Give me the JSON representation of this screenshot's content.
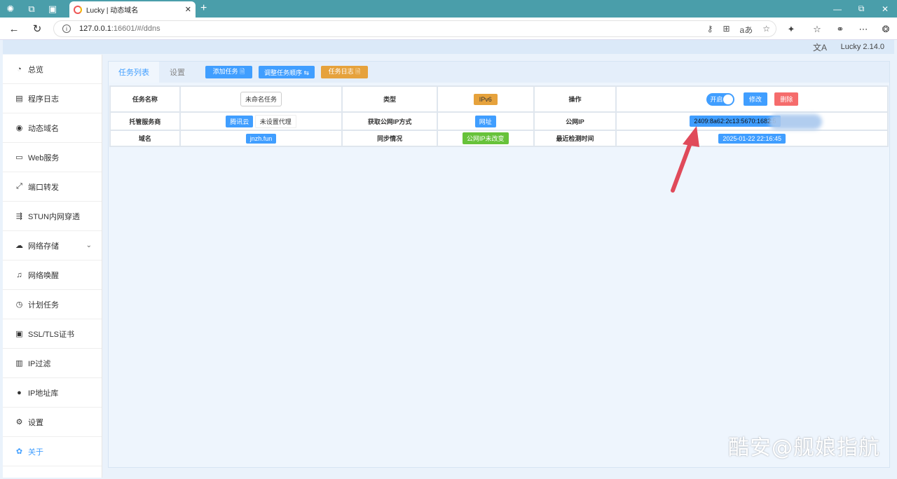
{
  "browser": {
    "tab_title": "Lucky | 动态域名",
    "tab_close": "✕",
    "new_tab": "+",
    "url_host": "127.0.0.1",
    "url_path": ":16601/#/ddns",
    "window_controls": [
      "—",
      "⧉",
      "✕"
    ]
  },
  "app": {
    "version": "Lucky 2.14.0",
    "lang_icon": "文A"
  },
  "sidebar": {
    "items": [
      {
        "label": "总览",
        "icon": "dashboard-icon",
        "glyph": "◔"
      },
      {
        "label": "程序日志",
        "icon": "log-icon",
        "glyph": "▤"
      },
      {
        "label": "动态域名",
        "icon": "dns-icon",
        "glyph": "◉"
      },
      {
        "label": "Web服务",
        "icon": "web-icon",
        "glyph": "▭"
      },
      {
        "label": "端口转发",
        "icon": "port-forward-icon",
        "glyph": "⤢"
      },
      {
        "label": "STUN内网穿透",
        "icon": "stun-icon",
        "glyph": "⇶"
      },
      {
        "label": "网络存储",
        "icon": "cloud-icon",
        "glyph": "☁"
      },
      {
        "label": "网络唤醒",
        "icon": "bell-icon",
        "glyph": "♫"
      },
      {
        "label": "计划任务",
        "icon": "clock-icon",
        "glyph": "◷"
      },
      {
        "label": "SSL/TLS证书",
        "icon": "certificate-icon",
        "glyph": "▣"
      },
      {
        "label": "IP过滤",
        "icon": "ip-filter-icon",
        "glyph": "▥"
      },
      {
        "label": "IP地址库",
        "icon": "user-icon",
        "glyph": "●"
      },
      {
        "label": "设置",
        "icon": "gear-icon",
        "glyph": "⚙"
      },
      {
        "label": "关于",
        "icon": "about-icon",
        "glyph": "✿"
      }
    ],
    "expand_glyph": "⌄"
  },
  "main": {
    "tabs": [
      {
        "label": "任务列表"
      },
      {
        "label": "设置"
      }
    ],
    "buttons": {
      "add_task": "添加任务 🗎",
      "reorder": "调整任务顺序 ⇆",
      "task_log": "任务日志 🗎"
    }
  },
  "task": {
    "row1": {
      "name_label": "任务名称",
      "name_value": "未命名任务",
      "type_label": "类型",
      "type_value": "IPv6",
      "ops_label": "操作",
      "switch_label": "开启",
      "edit": "修改",
      "delete": "删除"
    },
    "row2": {
      "provider_label": "托管服务商",
      "provider_value": "腾讯云",
      "proxy_value": "未设置代理",
      "method_label": "获取公网IP方式",
      "method_value": "网址",
      "public_ip_label": "公网IP",
      "public_ip_value": "2409:8a62:2c13:5670:1682:5"
    },
    "row3": {
      "domain_label": "域名",
      "domain_value": "jnzh.fun",
      "sync_label": "同步情况",
      "sync_value": "公网IP未改变",
      "last_check_label": "最近检测时间",
      "last_check_value": "2025-01-22 22:16:45"
    }
  },
  "watermark": "酷安@舰娘指航",
  "colors": {
    "primary": "#409eff",
    "warning": "#e6a23c",
    "success": "#67c23a",
    "danger": "#f56c6c",
    "arrow": "#e04a5a",
    "tabbar": "#4a9eaa"
  }
}
